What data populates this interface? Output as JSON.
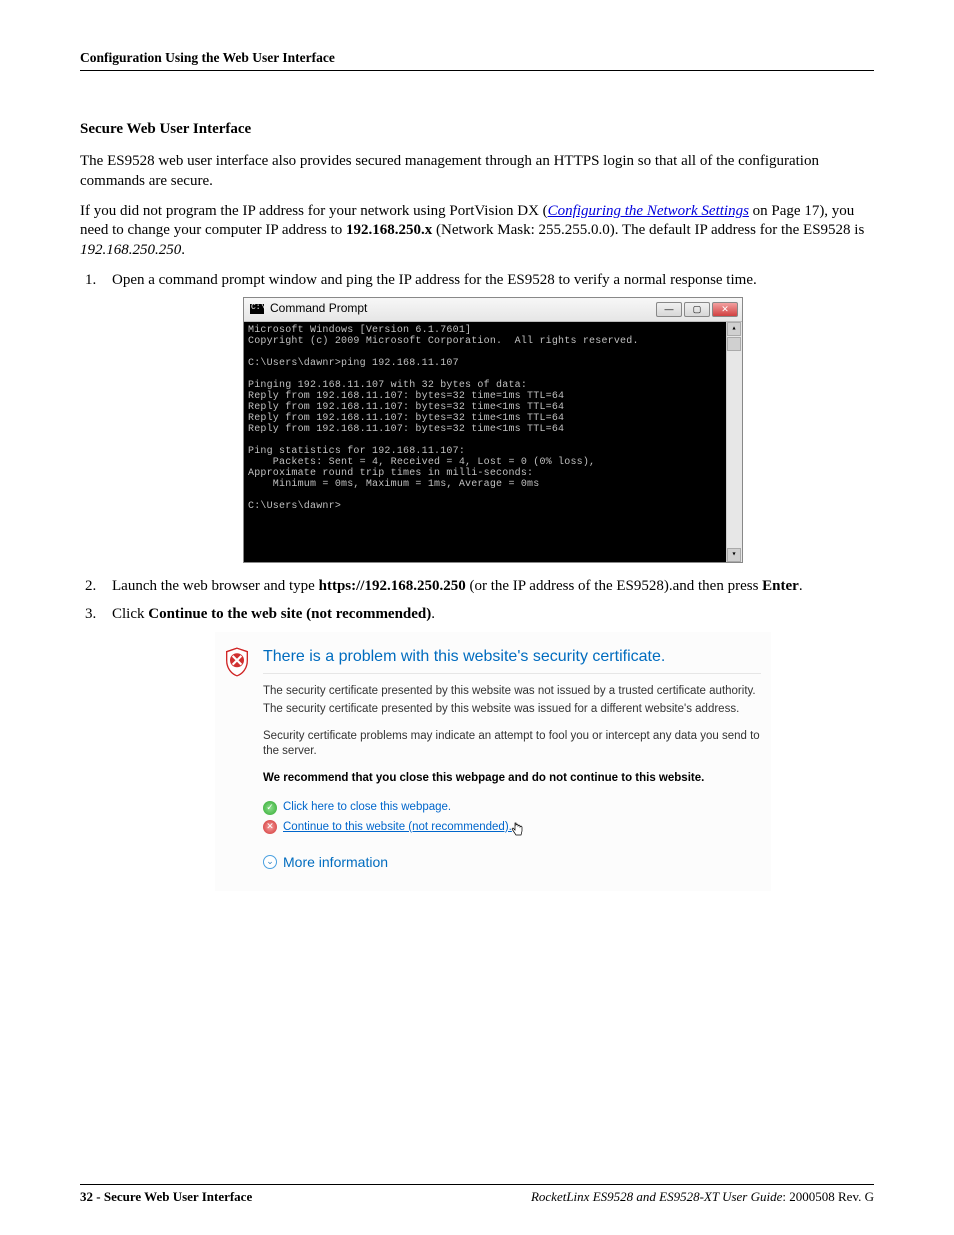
{
  "header": {
    "running": "Configuration Using the Web User Interface"
  },
  "section": {
    "title": "Secure Web User Interface",
    "para1": "The ES9528 web user interface also provides secured management through an HTTPS login so that all of the configuration commands are secure.",
    "para2_a": "If you did not program the IP address for your network using PortVision DX (",
    "para2_link": "Configuring the Network Settings",
    "para2_b": " on Page 17), you need to change your computer IP address to ",
    "para2_ip": "192.168.250.x",
    "para2_c": " (Network Mask: 255.255.0.0). The default IP address for the ES9528 is ",
    "para2_def": "192.168.250.250",
    "para2_end": "."
  },
  "steps": {
    "s1": "Open a command prompt window and ping the IP address for the ES9528 to verify a normal response time.",
    "s2_a": "Launch the web browser and type ",
    "s2_b": "https://192.168.250.250",
    "s2_c": " (or the IP address of the ES9528).and then press ",
    "s2_d": "Enter",
    "s2_e": ".",
    "s3_a": "Click ",
    "s3_b": "Continue to the web site (not recommended)",
    "s3_c": "."
  },
  "cmd": {
    "title": "Command Prompt",
    "body": "Microsoft Windows [Version 6.1.7601]\nCopyright (c) 2009 Microsoft Corporation.  All rights reserved.\n\nC:\\Users\\dawnr>ping 192.168.11.107\n\nPinging 192.168.11.107 with 32 bytes of data:\nReply from 192.168.11.107: bytes=32 time=1ms TTL=64\nReply from 192.168.11.107: bytes=32 time<1ms TTL=64\nReply from 192.168.11.107: bytes=32 time<1ms TTL=64\nReply from 192.168.11.107: bytes=32 time<1ms TTL=64\n\nPing statistics for 192.168.11.107:\n    Packets: Sent = 4, Received = 4, Lost = 0 (0% loss),\nApproximate round trip times in milli-seconds:\n    Minimum = 0ms, Maximum = 1ms, Average = 0ms\n\nC:\\Users\\dawnr>"
  },
  "cert": {
    "heading": "There is a problem with this website's security certificate.",
    "l1": "The security certificate presented by this website was not issued by a trusted certificate authority.",
    "l2": "The security certificate presented by this website was issued for a different website's address.",
    "l3": "Security certificate problems may indicate an attempt to fool you or intercept any data you send to the server.",
    "rec": "We recommend that you close this webpage and do not continue to this website.",
    "close": "Click here to close this webpage.",
    "cont": "Continue to this website (not recommended).",
    "more": "More information"
  },
  "footer": {
    "page": "32",
    "left": "Secure Web User Interface",
    "right_title": "RocketLinx ES9528 and ES9528-XT User Guide",
    "right_rev": ": 2000508 Rev. G"
  }
}
